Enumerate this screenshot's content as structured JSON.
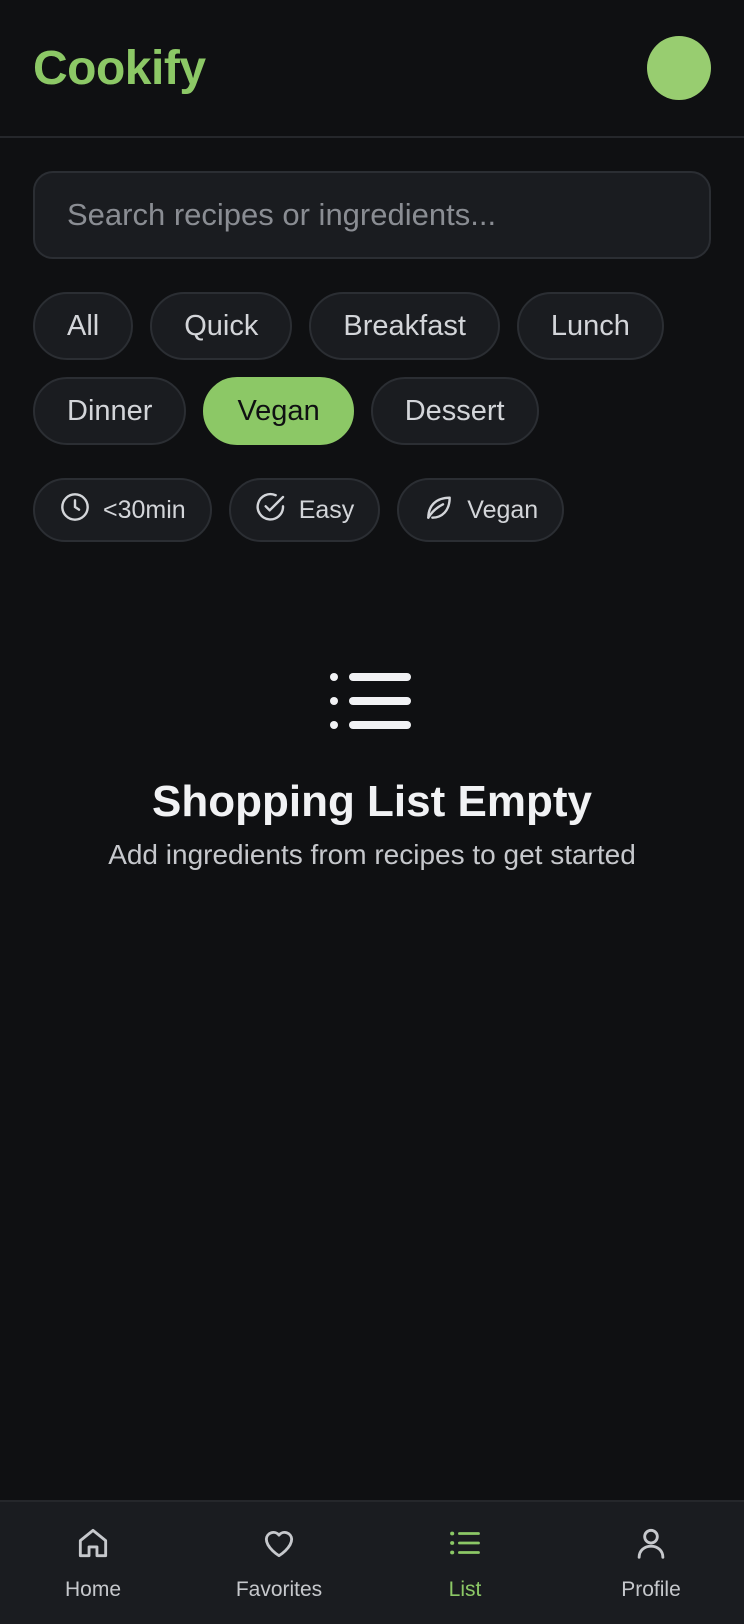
{
  "header": {
    "brand": "Cookify"
  },
  "search": {
    "placeholder": "Search recipes or ingredients..."
  },
  "categories": [
    "All",
    "Quick",
    "Breakfast",
    "Lunch",
    "Dinner",
    "Vegan",
    "Dessert"
  ],
  "active_category": "Vegan",
  "filters": [
    {
      "label": "<30min",
      "icon": "clock-icon"
    },
    {
      "label": "Easy",
      "icon": "check-circle-icon"
    },
    {
      "label": "Vegan",
      "icon": "leaf-icon"
    }
  ],
  "empty_state": {
    "icon": "list-icon",
    "title": "Shopping List Empty",
    "subtitle": "Add ingredients from recipes to get started"
  },
  "nav": [
    {
      "label": "Home",
      "icon": "home-icon"
    },
    {
      "label": "Favorites",
      "icon": "heart-icon"
    },
    {
      "label": "List",
      "icon": "list-icon"
    },
    {
      "label": "Profile",
      "icon": "user-icon"
    }
  ],
  "active_nav": "List",
  "colors": {
    "accent": "#8cc866",
    "background": "#0f1012",
    "surface": "#1a1c20"
  }
}
